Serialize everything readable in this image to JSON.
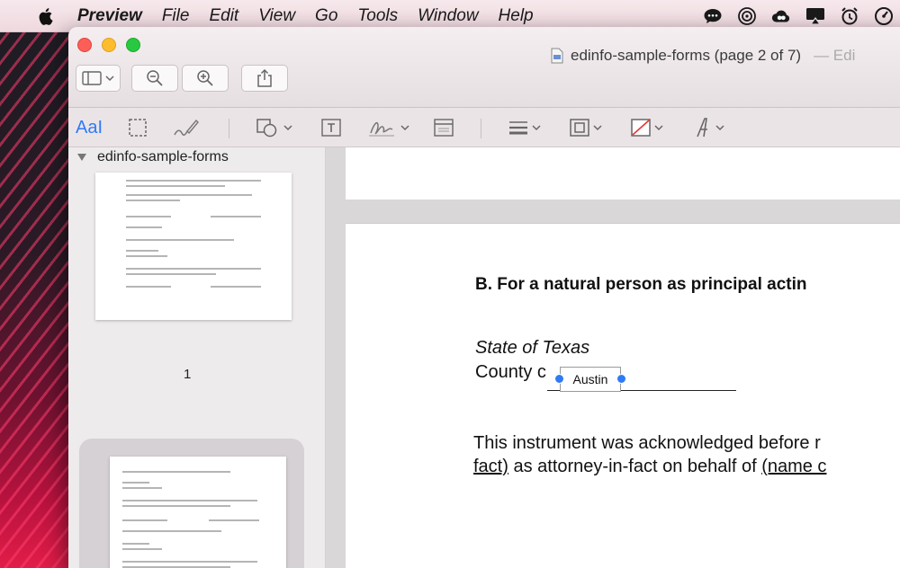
{
  "menubar": {
    "app_name": "Preview",
    "items": [
      "File",
      "Edit",
      "View",
      "Go",
      "Tools",
      "Window",
      "Help"
    ]
  },
  "window": {
    "title": "edinfo-sample-forms (page 2 of 7)",
    "title_suffix": "— Edi"
  },
  "markup": {
    "text_style_label": "AaI"
  },
  "sidebar": {
    "doc_name": "edinfo-sample-forms",
    "page1_label": "1"
  },
  "document": {
    "section_heading": "B. For a natural person as principal actin",
    "state_line": "State of Texas",
    "county_prefix": "County c",
    "field_value": "Austin",
    "para_line1": "This instrument was acknowledged before r",
    "para_line2_a": "fact)",
    "para_line2_b": " as attorney-in-fact on behalf of ",
    "para_line2_c": "(name c"
  },
  "colors": {
    "accent": "#2f7bf5",
    "close": "#fc5f57",
    "minimize": "#fdbc2e",
    "maximize": "#28c840"
  }
}
